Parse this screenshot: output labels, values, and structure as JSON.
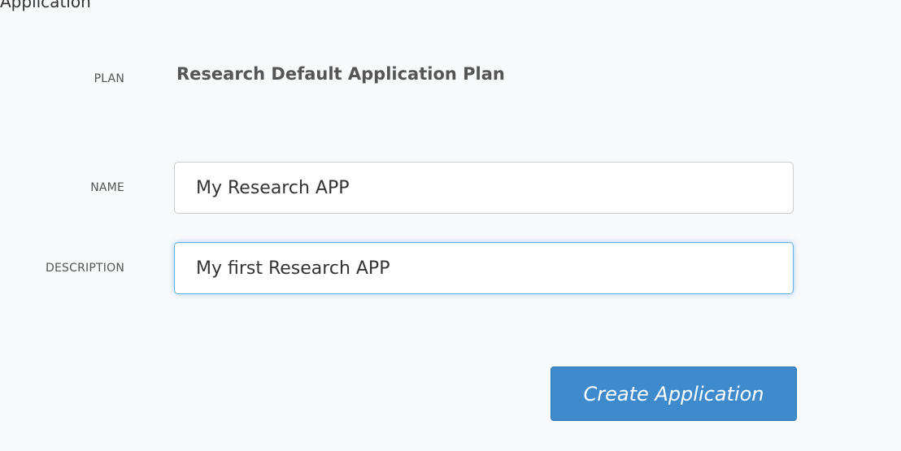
{
  "header": {
    "clipped_title": "Application"
  },
  "form": {
    "plan": {
      "label": "PLAN",
      "value": "Research Default Application Plan"
    },
    "name": {
      "label": "NAME",
      "value": "My Research APP"
    },
    "description": {
      "label": "DESCRIPTION",
      "value": "My first Research APP",
      "focused": true
    },
    "submit_label": "Create Application"
  },
  "colors": {
    "background": "#f8f9fb",
    "primary_button": "#3e8acc",
    "focus_border": "#66afe9",
    "label_text": "#555555"
  }
}
